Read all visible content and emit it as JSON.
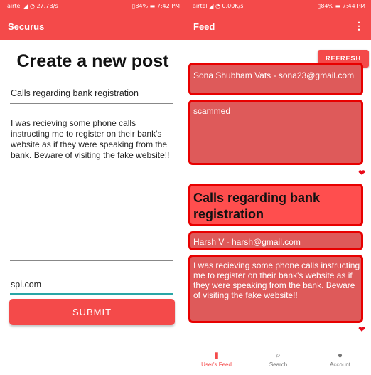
{
  "left": {
    "status": {
      "carrier": "airtel",
      "net": "27.7B/s",
      "battery": "84%",
      "time": "7:42 PM"
    },
    "appbar_title": "Securus",
    "heading": "Create a new post",
    "title_value": "Calls regarding bank registration",
    "description": "I was recieving some phone calls instructing me to register on their bank's website as if they were speaking from the bank. Beware of visiting the fake website!!",
    "url_value": "spi.com",
    "submit_label": "SUBMIT"
  },
  "right": {
    "status": {
      "carrier": "airtel",
      "net": "0.00K/s",
      "battery": "84%",
      "time": "7:44 PM"
    },
    "appbar_title": "Feed",
    "menu_icon": "more-vert-icon",
    "refresh_label": "REFRESH",
    "feed": {
      "post1_author": "Sona Shubham Vats - sona23@gmail.com",
      "post1_body": "scammed",
      "post2_title": "Calls regarding bank registration",
      "post2_author": "Harsh V - harsh@gmail.com",
      "post2_body": "I was recieving some phone calls instructing me to register on their bank's website as if they were speaking from the bank. Beware of visiting the fake website!!"
    },
    "nav": [
      {
        "label": "User's Feed",
        "icon": "feed-icon",
        "active": true
      },
      {
        "label": "Search",
        "icon": "search-icon",
        "active": false
      },
      {
        "label": "Account",
        "icon": "account-icon",
        "active": false
      }
    ]
  },
  "colors": {
    "primary": "#f44a4a",
    "card": "#de5a5a",
    "card_border": "#e80000",
    "focus": "#2aa6a6"
  }
}
